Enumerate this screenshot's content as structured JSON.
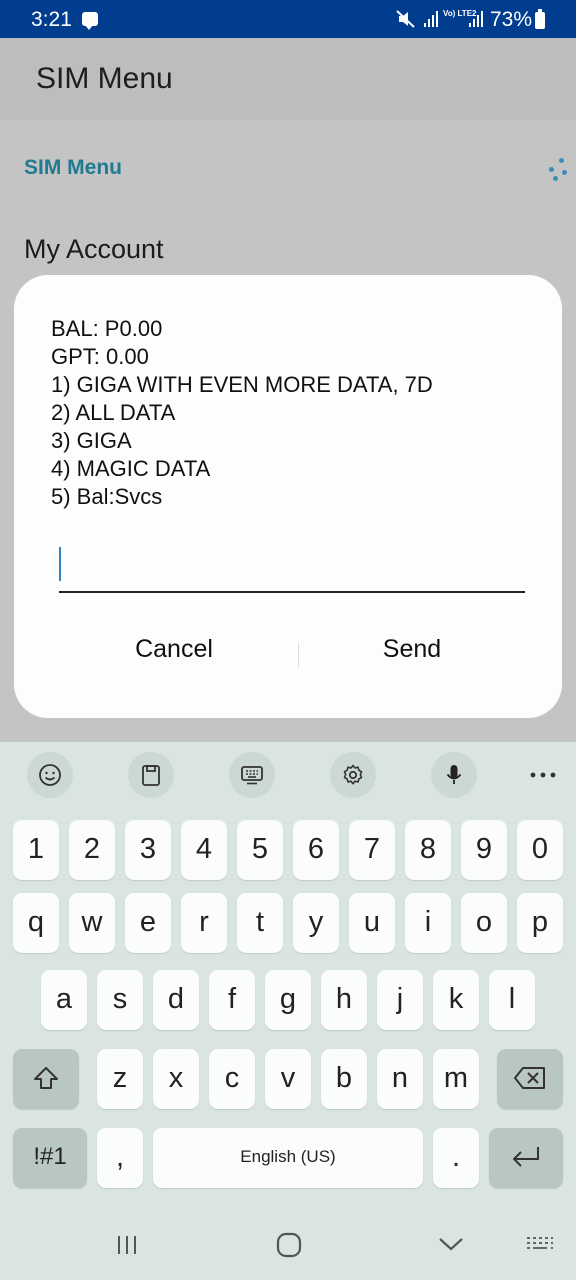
{
  "status_bar": {
    "time": "3:21",
    "network": "Vo) LTE2",
    "battery": "73%"
  },
  "app_bar": {
    "title": "SIM Menu"
  },
  "page": {
    "subtitle": "SIM Menu",
    "section_title": "My Account"
  },
  "dialog": {
    "lines": [
      "BAL: P0.00",
      "GPT: 0.00",
      "1) GIGA WITH EVEN MORE DATA, 7D",
      "2) ALL DATA",
      "3) GIGA",
      "4) MAGIC DATA",
      "5) Bal:Svcs"
    ],
    "input_value": "",
    "cancel_label": "Cancel",
    "send_label": "Send"
  },
  "keyboard": {
    "toolbar": [
      "emoji-icon",
      "clipboard-icon",
      "keyboard-icon",
      "settings-icon",
      "mic-icon",
      "more-icon"
    ],
    "row_numbers": [
      "1",
      "2",
      "3",
      "4",
      "5",
      "6",
      "7",
      "8",
      "9",
      "0"
    ],
    "row_1": [
      "q",
      "w",
      "e",
      "r",
      "t",
      "y",
      "u",
      "i",
      "o",
      "p"
    ],
    "row_2": [
      "a",
      "s",
      "d",
      "f",
      "g",
      "h",
      "j",
      "k",
      "l"
    ],
    "row_3": [
      "z",
      "x",
      "c",
      "v",
      "b",
      "n",
      "m"
    ],
    "symbols_label": "!#1",
    "comma_label": ",",
    "space_label": "English (US)",
    "period_label": "."
  },
  "colors": {
    "status_bar": "#003d8f",
    "accent": "#1f7a92",
    "keyboard_bg": "#dae5df"
  }
}
